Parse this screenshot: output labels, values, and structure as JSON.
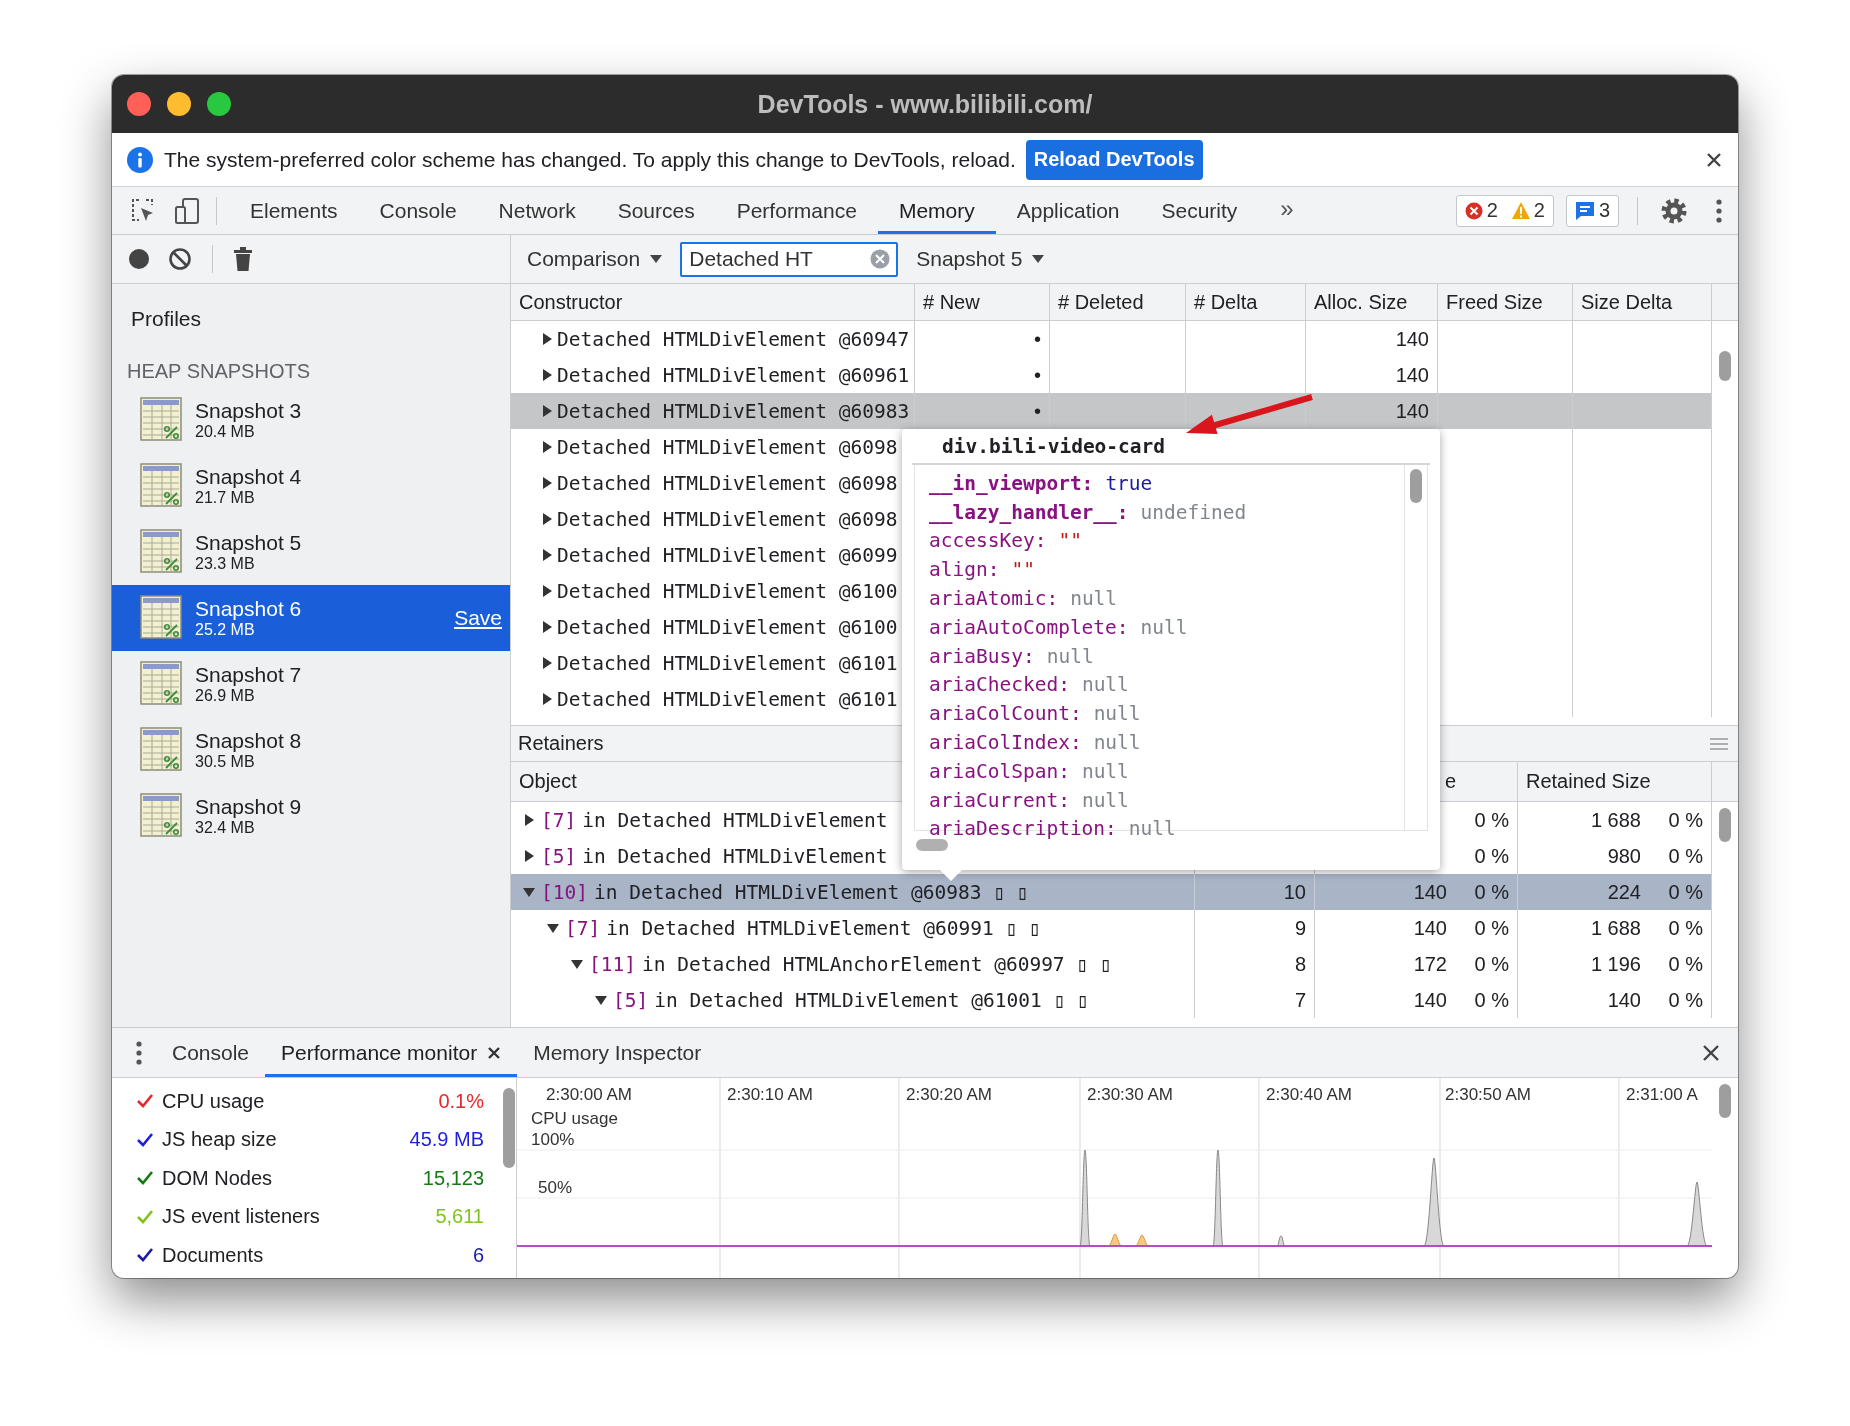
{
  "window": {
    "title": "DevTools - www.bilibili.com/"
  },
  "infobar": {
    "message": "The system-preferred color scheme has changed. To apply this change to DevTools, reload.",
    "button": "Reload DevTools"
  },
  "tabs": [
    {
      "label": "Elements",
      "selected": false
    },
    {
      "label": "Console",
      "selected": false
    },
    {
      "label": "Network",
      "selected": false
    },
    {
      "label": "Sources",
      "selected": false
    },
    {
      "label": "Performance",
      "selected": false
    },
    {
      "label": "Memory",
      "selected": true
    },
    {
      "label": "Application",
      "selected": false
    },
    {
      "label": "Security",
      "selected": false
    }
  ],
  "overflow": "»",
  "issues": [
    {
      "kind": "error",
      "count": "2"
    },
    {
      "kind": "warning",
      "count": "2"
    }
  ],
  "messages": {
    "count": "3"
  },
  "sidebar": {
    "title": "Profiles",
    "section": "HEAP SNAPSHOTS",
    "items": [
      {
        "name": "Snapshot 3",
        "size": "20.4 MB",
        "selected": false
      },
      {
        "name": "Snapshot 4",
        "size": "21.7 MB",
        "selected": false
      },
      {
        "name": "Snapshot 5",
        "size": "23.3 MB",
        "selected": false
      },
      {
        "name": "Snapshot 6",
        "size": "25.2 MB",
        "selected": true,
        "action": "Save"
      },
      {
        "name": "Snapshot 7",
        "size": "26.9 MB",
        "selected": false
      },
      {
        "name": "Snapshot 8",
        "size": "30.5 MB",
        "selected": false
      },
      {
        "name": "Snapshot 9",
        "size": "32.4 MB",
        "selected": false
      }
    ]
  },
  "toolbar": {
    "view": "Comparison",
    "filter": {
      "value": "Detached HT"
    },
    "baseline": "Snapshot 5"
  },
  "constructor_table": {
    "columns": [
      "Constructor",
      "# New",
      "# Deleted",
      "# Delta",
      "Alloc. Size",
      "Freed Size",
      "Size Delta"
    ],
    "rows": [
      {
        "name": "Detached HTMLDivElement @60947",
        "new": "•",
        "alloc": "140",
        "expanded": false,
        "selected": false
      },
      {
        "name": "Detached HTMLDivElement @60961",
        "new": "•",
        "alloc": "140",
        "expanded": false,
        "selected": false
      },
      {
        "name": "Detached HTMLDivElement @60983",
        "new": "•",
        "alloc": "140",
        "expanded": false,
        "selected": true
      },
      {
        "name": "Detached HTMLDivElement @6098",
        "expanded": false,
        "selected": false
      },
      {
        "name": "Detached HTMLDivElement @6098",
        "expanded": false,
        "selected": false
      },
      {
        "name": "Detached HTMLDivElement @6098",
        "expanded": false,
        "selected": false
      },
      {
        "name": "Detached HTMLDivElement @6099",
        "expanded": false,
        "selected": false
      },
      {
        "name": "Detached HTMLDivElement @6100",
        "expanded": false,
        "selected": false
      },
      {
        "name": "Detached HTMLDivElement @6100",
        "expanded": false,
        "selected": false
      },
      {
        "name": "Detached HTMLDivElement @6101",
        "expanded": false,
        "selected": false
      },
      {
        "name": "Detached HTMLDivElement @6101",
        "expanded": false,
        "selected": false
      }
    ]
  },
  "retainers": {
    "title": "Retainers",
    "columns": {
      "object": "Object",
      "column_3": "e",
      "retained": "Retained Size"
    },
    "rows": [
      {
        "index": "[7]",
        "text": "in Detached HTMLDivElement",
        "shallow_pct": "0 %",
        "retained": "1 688",
        "retained_pct": "0 %",
        "expanded": false,
        "selected": false
      },
      {
        "index": "[5]",
        "text": "in Detached HTMLDivElement",
        "shallow_pct": "0 %",
        "retained": "980",
        "retained_pct": "0 %",
        "expanded": false,
        "selected": false
      },
      {
        "index": "[10]",
        "text": "in Detached HTMLDivElement @60983 ▯ ▯",
        "distance": "10",
        "shallow": "140",
        "shallow_pct": "0 %",
        "retained": "224",
        "retained_pct": "0 %",
        "expanded": true,
        "selected": true,
        "children": [
          {
            "index": "[7]",
            "text": "in Detached HTMLDivElement @60991 ▯ ▯",
            "distance": "9",
            "shallow": "140",
            "shallow_pct": "0 %",
            "retained": "1 688",
            "retained_pct": "0 %",
            "expanded": true,
            "selected": false,
            "children": [
              {
                "index": "[11]",
                "text": "in Detached HTMLAnchorElement @60997 ▯ ▯",
                "distance": "8",
                "shallow": "172",
                "shallow_pct": "0 %",
                "retained": "1 196",
                "retained_pct": "0 %",
                "expanded": true,
                "selected": false,
                "children": [
                  {
                    "index": "[5]",
                    "text": "in Detached HTMLDivElement @61001 ▯ ▯",
                    "distance": "7",
                    "shallow": "140",
                    "shallow_pct": "0 %",
                    "retained": "140",
                    "retained_pct": "0 %",
                    "expanded": true,
                    "selected": false
                  }
                ]
              }
            ]
          }
        ]
      }
    ]
  },
  "popover": {
    "title": "div.bili-video-card",
    "properties": [
      {
        "key": "__in_viewport:",
        "value": "true",
        "kind": "boolean",
        "own": true
      },
      {
        "key": "__lazy_handler__:",
        "value": "undefined",
        "kind": "undefined",
        "own": true
      },
      {
        "key": "accessKey:",
        "value": "\"\"",
        "kind": "string",
        "own": false
      },
      {
        "key": "align:",
        "value": "\"\"",
        "kind": "string",
        "own": false
      },
      {
        "key": "ariaAtomic:",
        "value": "null",
        "kind": "null",
        "own": false
      },
      {
        "key": "ariaAutoComplete:",
        "value": "null",
        "kind": "null",
        "own": false
      },
      {
        "key": "ariaBusy:",
        "value": "null",
        "kind": "null",
        "own": false
      },
      {
        "key": "ariaChecked:",
        "value": "null",
        "kind": "null",
        "own": false
      },
      {
        "key": "ariaColCount:",
        "value": "null",
        "kind": "null",
        "own": false
      },
      {
        "key": "ariaColIndex:",
        "value": "null",
        "kind": "null",
        "own": false
      },
      {
        "key": "ariaColSpan:",
        "value": "null",
        "kind": "null",
        "own": false
      },
      {
        "key": "ariaCurrent:",
        "value": "null",
        "kind": "null",
        "own": false
      },
      {
        "key": "ariaDescription:",
        "value": "null",
        "kind": "null",
        "own": false
      }
    ]
  },
  "drawer": {
    "tabs": [
      {
        "label": "Console",
        "selected": false,
        "closable": false
      },
      {
        "label": "Performance monitor",
        "selected": true,
        "closable": true
      },
      {
        "label": "Memory Inspector",
        "selected": false,
        "closable": false
      }
    ]
  },
  "metrics": [
    {
      "label": "CPU usage",
      "value": "0.1%",
      "color": "#e8262c",
      "checked": true
    },
    {
      "label": "JS heap size",
      "value": "45.9 MB",
      "color": "#1f1fe0",
      "checked": true
    },
    {
      "label": "DOM Nodes",
      "value": "15,123",
      "color": "#147a14",
      "checked": true
    },
    {
      "label": "JS event listeners",
      "value": "5,611",
      "color": "#7fc41c",
      "checked": true
    },
    {
      "label": "Documents",
      "value": "6",
      "color": "#1a1aa6",
      "checked": true
    }
  ],
  "monitor_chart": {
    "time_labels": [
      "2:30:00 AM",
      "2:30:10 AM",
      "2:30:20 AM",
      "2:30:30 AM",
      "2:30:40 AM",
      "2:30:50 AM",
      "2:31:00 A"
    ],
    "series_label": "CPU usage",
    "gridlines": [
      "100%",
      "50%"
    ]
  }
}
